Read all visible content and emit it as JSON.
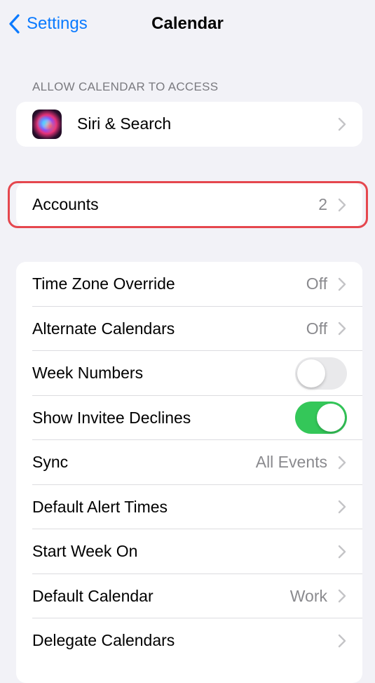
{
  "nav": {
    "back_label": "Settings",
    "title": "Calendar"
  },
  "access_section": {
    "header": "ALLOW CALENDAR TO ACCESS",
    "items": [
      {
        "label": "Siri & Search",
        "icon": "siri-icon"
      }
    ]
  },
  "accounts": {
    "label": "Accounts",
    "value": "2",
    "highlight_color": "#e5474e"
  },
  "settings": {
    "items": [
      {
        "label": "Time Zone Override",
        "value": "Off"
      },
      {
        "label": "Alternate Calendars",
        "value": "Off"
      },
      {
        "label": "Week Numbers",
        "toggle": false
      },
      {
        "label": "Show Invitee Declines",
        "toggle": true
      },
      {
        "label": "Sync",
        "value": "All Events"
      },
      {
        "label": "Default Alert Times",
        "value": ""
      },
      {
        "label": "Start Week On",
        "value": ""
      },
      {
        "label": "Default Calendar",
        "value": "Work"
      },
      {
        "label": "Delegate Calendars",
        "value": ""
      }
    ]
  },
  "colors": {
    "accent": "#0a7aff",
    "toggle_on": "#34c759",
    "background": "#f2f2f7"
  }
}
